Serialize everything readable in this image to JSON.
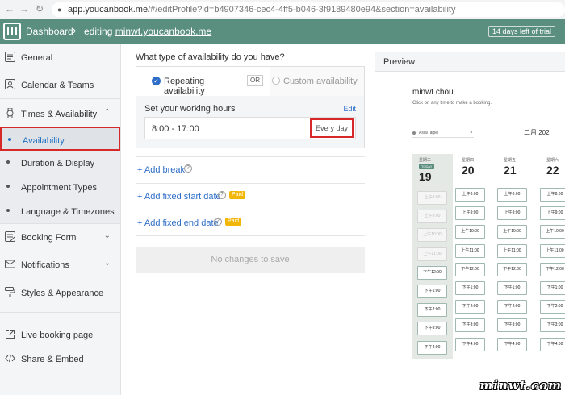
{
  "browser": {
    "back": "←",
    "forward": "→",
    "reload": "↻",
    "url_host": "app.youcanbook.me",
    "url_path": "/#/editProfile?id=b4907346-cec4-4ff5-b046-3f9189480e94&section=availability"
  },
  "header": {
    "dashboard": "Dashboard",
    "editing_prefix": "editing ",
    "editing_link": "minwt.youcanbook.me",
    "trial": "14 days left of trial"
  },
  "sidebar": {
    "general": "General",
    "calendar_teams": "Calendar & Teams",
    "times_availability": "Times & Availability",
    "sub": {
      "availability": "Availability",
      "duration": "Duration & Display",
      "appointment_types": "Appointment Types",
      "language": "Language & Timezones"
    },
    "booking_form": "Booking Form",
    "notifications": "Notifications",
    "styles": "Styles & Appearance",
    "live_page": "Live booking page",
    "share_embed": "Share & Embed"
  },
  "main": {
    "question": "What type of availability do you have?",
    "repeating": "Repeating availability",
    "or": "OR",
    "custom": "Custom availability",
    "working_hours_label": "Set your working hours",
    "edit": "Edit",
    "hours": "8:00 - 17:00",
    "every_day": "Every day",
    "add_break": "+ Add break",
    "add_fixed_start": "+ Add fixed start date",
    "add_fixed_end": "+ Add fixed end date",
    "paid": "Paid",
    "no_changes": "No changes to save"
  },
  "preview": {
    "title": "Preview",
    "name": "minwt chou",
    "subtitle": "Click on any time to make a booking.",
    "timezone": "Asia/Taipei",
    "month": "二月 202",
    "today_badge": "TODAY",
    "days": [
      {
        "name": "星期三",
        "num": "19",
        "today": true,
        "slots": [
          {
            "t": "上午8:00",
            "off": true
          },
          {
            "t": "上午9:00",
            "off": true
          },
          {
            "t": "上午10:00",
            "off": true
          },
          {
            "t": "上午11:00",
            "off": true
          },
          {
            "t": "下午12:00",
            "off": false
          },
          {
            "t": "下午1:00",
            "off": false
          },
          {
            "t": "下午2:00",
            "off": false
          },
          {
            "t": "下午3:00",
            "off": false
          },
          {
            "t": "下午4:00",
            "off": false
          }
        ]
      },
      {
        "name": "星期四",
        "num": "20",
        "today": false,
        "slots": [
          {
            "t": "上午8:00",
            "off": false
          },
          {
            "t": "上午9:00",
            "off": false
          },
          {
            "t": "上午10:00",
            "off": false
          },
          {
            "t": "上午11:00",
            "off": false
          },
          {
            "t": "下午12:00",
            "off": false
          },
          {
            "t": "下午1:00",
            "off": false
          },
          {
            "t": "下午2:00",
            "off": false
          },
          {
            "t": "下午3:00",
            "off": false
          },
          {
            "t": "下午4:00",
            "off": false
          }
        ]
      },
      {
        "name": "星期五",
        "num": "21",
        "today": false,
        "slots": [
          {
            "t": "上午8:00",
            "off": false
          },
          {
            "t": "上午9:00",
            "off": false
          },
          {
            "t": "上午10:00",
            "off": false
          },
          {
            "t": "上午11:00",
            "off": false
          },
          {
            "t": "下午12:00",
            "off": false
          },
          {
            "t": "下午1:00",
            "off": false
          },
          {
            "t": "下午2:00",
            "off": false
          },
          {
            "t": "下午3:00",
            "off": false
          },
          {
            "t": "下午4:00",
            "off": false
          }
        ]
      },
      {
        "name": "星期六",
        "num": "22",
        "today": false,
        "slots": [
          {
            "t": "上午8:00",
            "off": false
          },
          {
            "t": "上午9:00",
            "off": false
          },
          {
            "t": "上午10:00",
            "off": false
          },
          {
            "t": "上午11:00",
            "off": false
          },
          {
            "t": "下午12:00",
            "off": false
          },
          {
            "t": "下午1:00",
            "off": false
          },
          {
            "t": "下午2:00",
            "off": false
          },
          {
            "t": "下午3:00",
            "off": false
          },
          {
            "t": "下午4:00",
            "off": false
          }
        ]
      }
    ]
  },
  "watermark": "minwt.com",
  "colors": {
    "header": "#5a8e7e",
    "link": "#2f6ec8",
    "highlight": "#d62828",
    "paid": "#f2b705"
  }
}
